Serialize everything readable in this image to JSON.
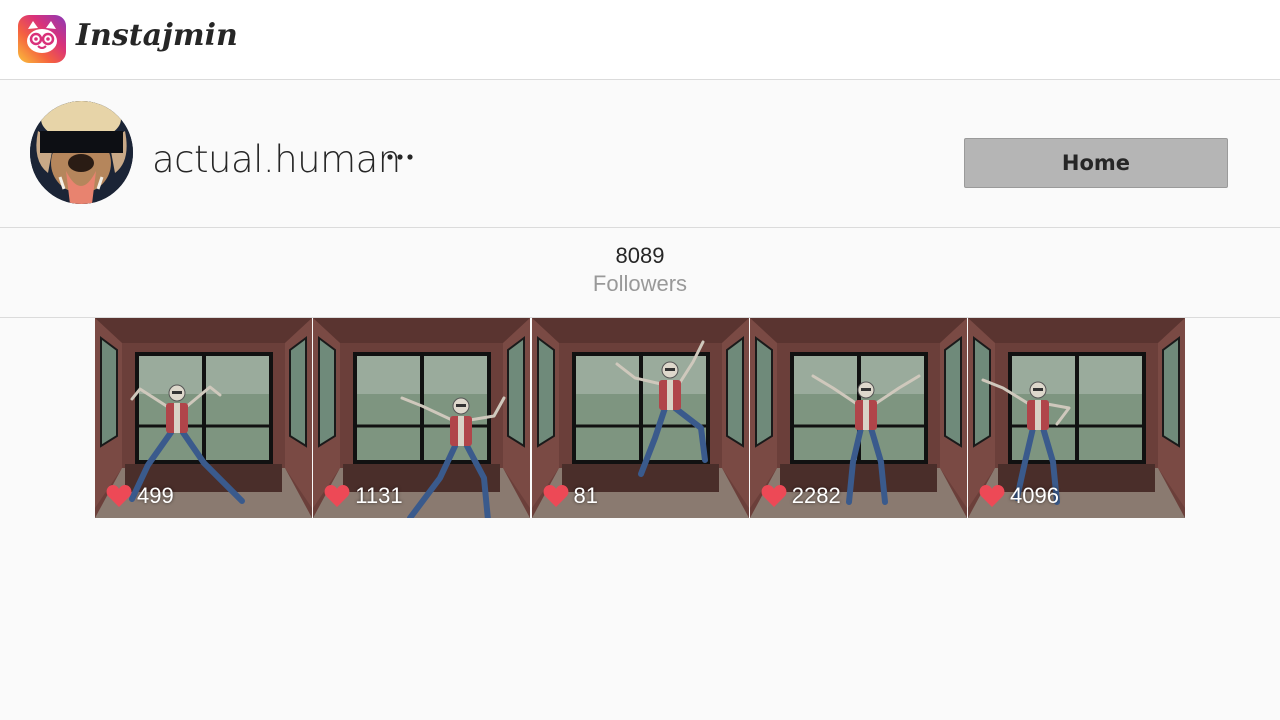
{
  "app": {
    "name": "Instajmin",
    "logo_icon": "cat-face-logo-icon"
  },
  "profile": {
    "username": "actual.human",
    "more_icon": "ellipsis-icon",
    "home_label": "Home"
  },
  "stats": {
    "followers_count": "8089",
    "followers_label": "Followers"
  },
  "posts": [
    {
      "likes": "499",
      "pose": "squat"
    },
    {
      "likes": "1131",
      "pose": "lunge"
    },
    {
      "likes": "81",
      "pose": "kick"
    },
    {
      "likes": "2282",
      "pose": "arms-up"
    },
    {
      "likes": "4096",
      "pose": "hands-hips"
    }
  ],
  "colors": {
    "heart": "#ed4956",
    "home_button": "#b5b5b5",
    "background": "#fafafa"
  }
}
